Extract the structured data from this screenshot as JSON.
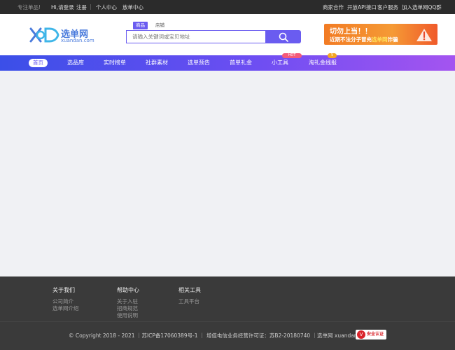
{
  "topbar": {
    "slogan": "专注单品!",
    "login": "Hi,请登录",
    "register": "注册",
    "sep": "|",
    "user_center": "个人中心",
    "release_center": "放单中心",
    "right_links": [
      "商家合作",
      "开放API接口",
      "客户服务",
      "加入选单网QQ群"
    ]
  },
  "logo": {
    "name": "选单网",
    "domain": "xuandan.com"
  },
  "search": {
    "tabs": [
      "商品",
      "店铺"
    ],
    "active_tab": "商品",
    "placeholder": "请输入关键词或宝贝地址",
    "icon": "search-icon"
  },
  "banner": {
    "line1": "切勿上当！！",
    "line2_a": "近期不法分子冒充",
    "line2_b": "选单网",
    "line2_c": "诈骗"
  },
  "nav": {
    "items": [
      "首页",
      "选品库",
      "实时榜单",
      "社群素材",
      "选单预告",
      "首单礼金",
      "小工具",
      "淘礼金线报"
    ],
    "active": "首页",
    "tag_hot": "HOT",
    "tag_gold": "￥"
  },
  "footer": {
    "columns": [
      {
        "title": "关于我们",
        "items": [
          "公司简介",
          "选单网介绍"
        ]
      },
      {
        "title": "帮助中心",
        "items": [
          "关于入驻",
          "招商规范",
          "使用说明"
        ]
      },
      {
        "title": "相关工具",
        "items": [
          "工具平台"
        ]
      }
    ],
    "copyright": "© Copyright 2018 - 2021 ｜苏ICP备17060389号-1 ｜ 增值电信业务经营许可证：苏B2-20180740 ｜选单网 xuandan.com",
    "badge_text": "安全认证",
    "badge_mark": "V"
  },
  "colors": {
    "accent": "#6a5cf0",
    "topbar": "#2b2b2b",
    "footer": "#3a3a3a",
    "banner": "#f27b24"
  }
}
